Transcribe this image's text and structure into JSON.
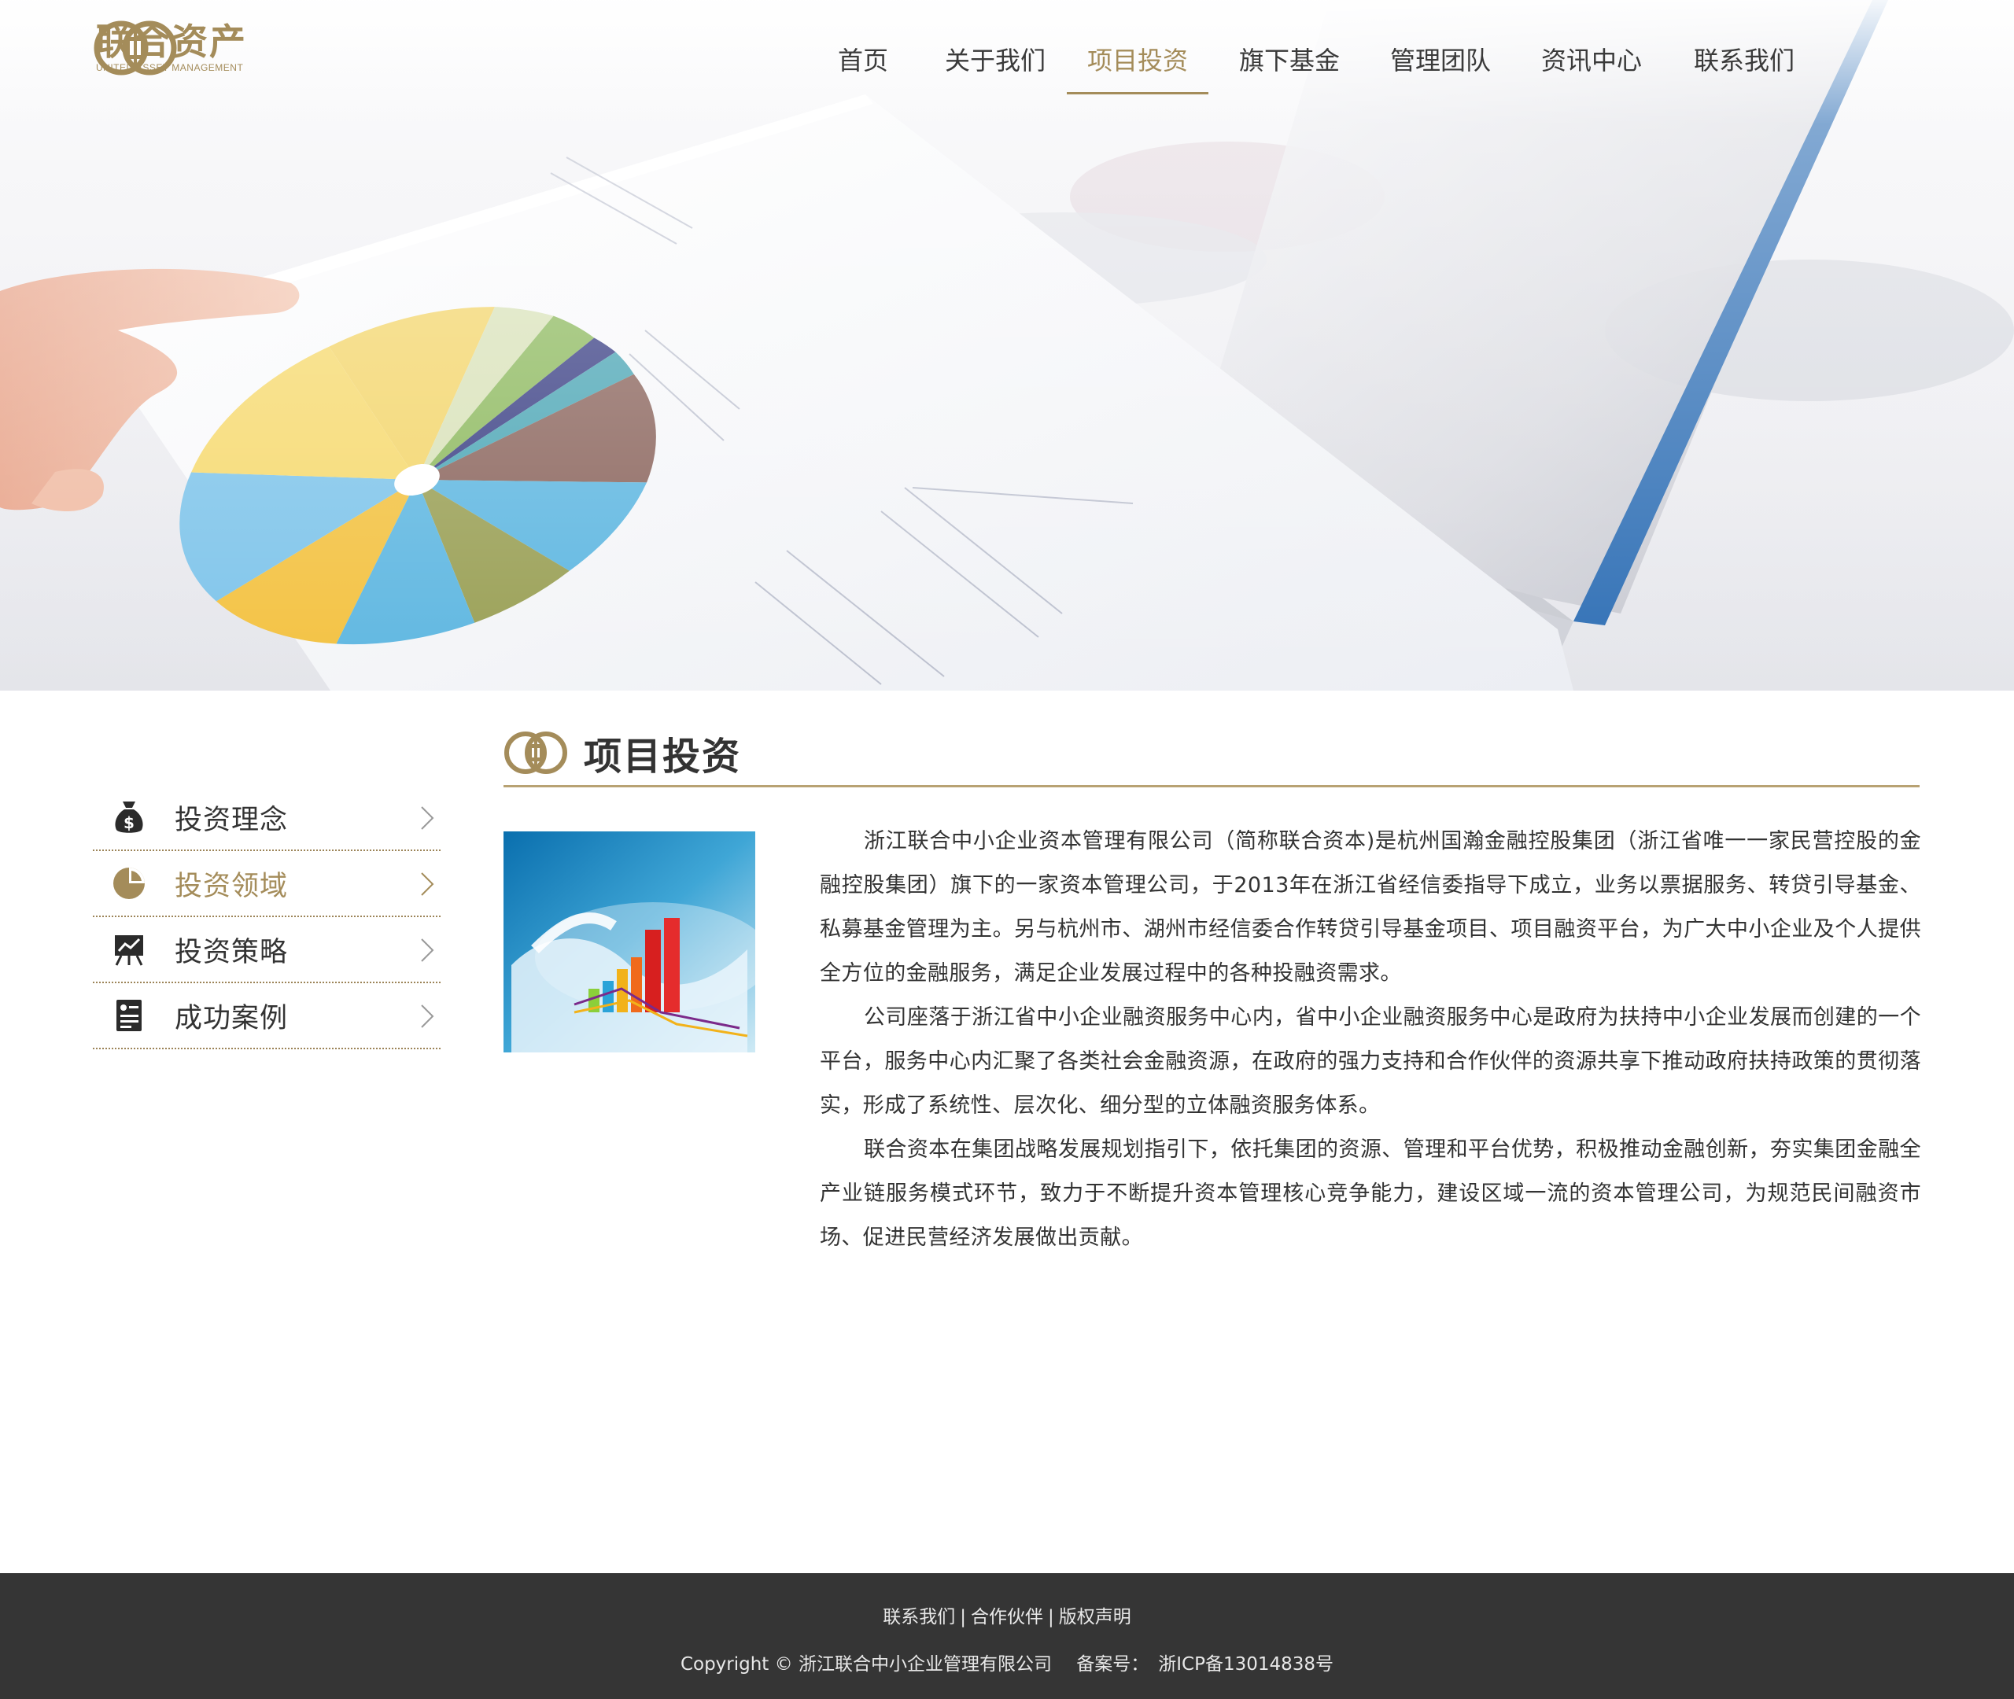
{
  "brand": {
    "name_cn": "联合资产",
    "name_en": "UNITED ASSET MANAGEMENT",
    "color": "#a48c5a"
  },
  "nav": {
    "items": [
      {
        "label": "首页"
      },
      {
        "label": "关于我们"
      },
      {
        "label": "项目投资",
        "active": true
      },
      {
        "label": "旗下基金"
      },
      {
        "label": "管理团队"
      },
      {
        "label": "资讯中心"
      },
      {
        "label": "联系我们"
      }
    ]
  },
  "sidebar": {
    "items": [
      {
        "label": "投资理念",
        "icon": "money-bag-icon"
      },
      {
        "label": "投资领域",
        "icon": "pie-chart-icon",
        "active": true
      },
      {
        "label": "投资策略",
        "icon": "presentation-board-icon"
      },
      {
        "label": "成功案例",
        "icon": "document-icon"
      }
    ]
  },
  "main": {
    "title": "项目投资",
    "paragraphs": [
      "浙江联合中小企业资本管理有限公司（简称联合资本)是杭州国瀚金融控股集团（浙江省唯一一家民营控股的金融控股集团）旗下的一家资本管理公司，于2013年在浙江省经信委指导下成立，业务以票据服务、转贷引导基金、私募基金管理为主。另与杭州市、湖州市经信委合作转贷引导基金项目、项目融资平台，为广大中小企业及个人提供全方位的金融服务，满足企业发展过程中的各种投融资需求。",
      "公司座落于浙江省中小企业融资服务中心内，省中小企业融资服务中心是政府为扶持中小企业发展而创建的一个平台，服务中心内汇聚了各类社会金融资源，在政府的强力支持和合作伙伴的资源共享下推动政府扶持政策的贯彻落实，形成了系统性、层次化、细分型的立体融资服务体系。",
      "联合资本在集团战略发展规划指引下，依托集团的资源、管理和平台优势，积极推动金融创新，夯实集团金融全产业链服务模式环节，致力于不断提升资本管理核心竞争能力，建设区域一流的资本管理公司，为规范民间融资市场、促进民营经济发展做出贡献。"
    ]
  },
  "footer": {
    "links": [
      "联系我们",
      "合作伙伴",
      "版权声明"
    ],
    "separator": "|",
    "copyright": "Copyright © 浙江联合中小企业管理有限公司",
    "icp_label": "备案号：",
    "icp_value": "浙ICP备13014838号"
  }
}
